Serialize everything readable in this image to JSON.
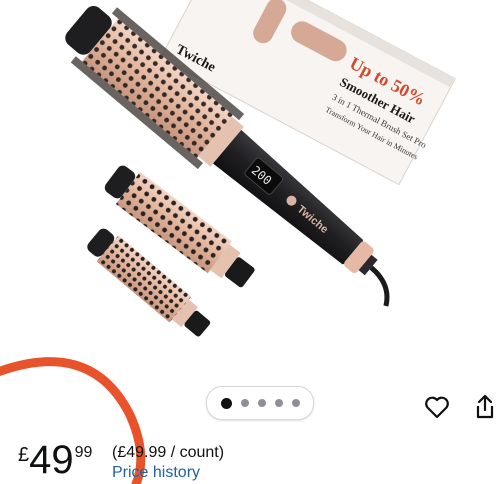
{
  "product": {
    "box_brand": "Twiche",
    "box_headline": "Up to 50%",
    "box_subline": "Smoother Hair",
    "box_desc": "3 in 1 Thermal Brush Set Pro",
    "box_tagline": "Transform Your Hair in Minutes",
    "display_temp": "200",
    "handle_brand": "Twiche"
  },
  "carousel": {
    "count": 5,
    "active_index": 0
  },
  "actions": {
    "wishlist_icon": "heart-icon",
    "share_icon": "share-icon"
  },
  "price": {
    "currency": "£",
    "whole": "49",
    "fraction": "99",
    "unit_price": "(£49.99 / count)",
    "history_link": "Price history"
  },
  "colors": {
    "link": "#2162a1",
    "accent_arc": "#e8532c",
    "brush_gold": "#e3b9a2",
    "handle": "#1f1f22"
  }
}
